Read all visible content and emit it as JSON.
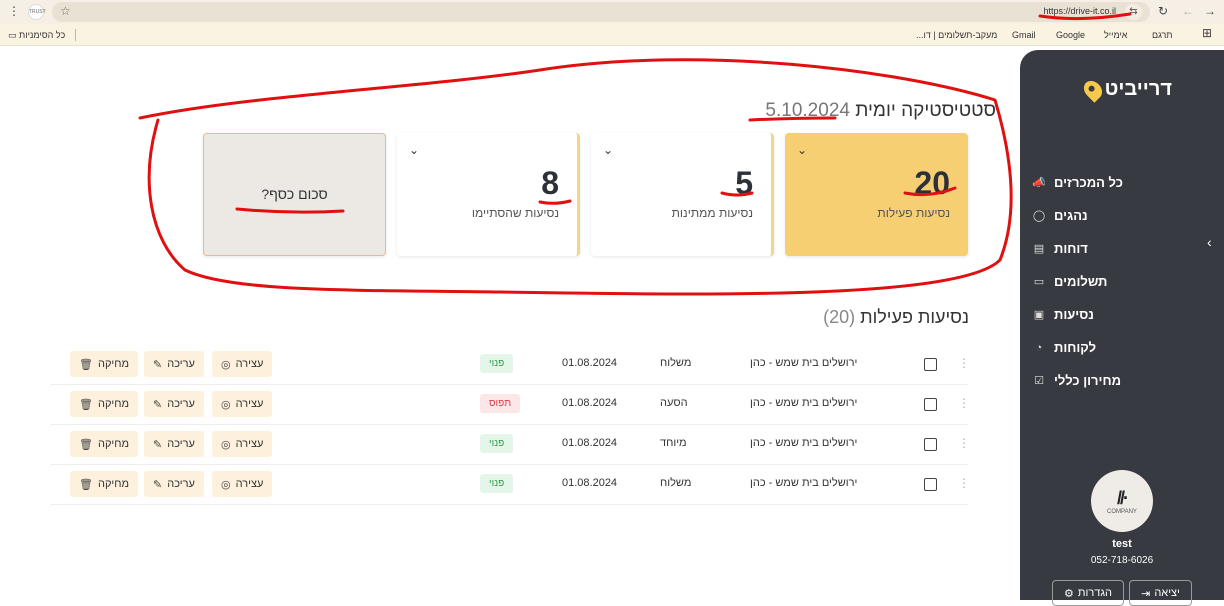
{
  "browser": {
    "url": "https://drive-it.co.il",
    "tune_icon": "tune-icon",
    "star_icon": "star-icon",
    "menu_icon": "kebab-menu-icon",
    "reload_icon": "reload-icon",
    "back_icon": "back-arrow-icon",
    "forward_icon": "forward-arrow-icon",
    "apps_icon": "apps-grid-icon",
    "extension_logo_text": "TRUST"
  },
  "bookmarks": {
    "items": [
      "תרגם",
      "אימייל",
      "Google",
      "Gmail",
      "מעקב-תשלומים | דו..."
    ],
    "all_bookmarks": "כל הסימניות"
  },
  "sidebar": {
    "logo": "דרייביט",
    "items": [
      {
        "label": "כל המכרזים",
        "icon": "megaphone-icon"
      },
      {
        "label": "נהגים",
        "icon": "user-icon"
      },
      {
        "label": "דוחות",
        "icon": "report-icon"
      },
      {
        "label": "תשלומים",
        "icon": "credit-card-icon"
      },
      {
        "label": "נסיעות",
        "icon": "bus-icon"
      },
      {
        "label": "לקוחות",
        "icon": "customers-icon"
      },
      {
        "label": "מחירון כללי",
        "icon": "price-list-icon"
      }
    ],
    "user": {
      "name": "test",
      "phone": "052-718-6026",
      "company": "COMPANY"
    },
    "logout": "יציאה",
    "settings": "הגדרות"
  },
  "stats": {
    "title": "סטטיסטיקה יומית",
    "date": "5.10.2024",
    "cards": [
      {
        "value": "20",
        "label": "נסיעות פעילות"
      },
      {
        "value": "5",
        "label": "נסיעות ממתינות"
      },
      {
        "value": "8",
        "label": "נסיעות שהסתיימו"
      }
    ],
    "money_label": "סכום כסף?"
  },
  "active_rides": {
    "title": "נסיעות פעילות",
    "count": "(20)",
    "actions": {
      "stop": "עצירה",
      "edit": "עריכה",
      "delete": "מחיקה"
    },
    "rows": [
      {
        "route": "ירושלים בית שמש - כהן",
        "vehicle": "משלוח",
        "date": "01.08.2024",
        "status": "פנוי",
        "status_type": "free"
      },
      {
        "route": "ירושלים בית שמש - כהן",
        "vehicle": "הסעה",
        "date": "01.08.2024",
        "status": "תפוס",
        "status_type": "busy"
      },
      {
        "route": "ירושלים בית שמש - כהן",
        "vehicle": "מיוחד",
        "date": "01.08.2024",
        "status": "פנוי",
        "status_type": "free"
      },
      {
        "route": "ירושלים בית שמש - כהן",
        "vehicle": "משלוח",
        "date": "01.08.2024",
        "status": "פנוי",
        "status_type": "free"
      }
    ]
  },
  "colors": {
    "accent": "#f6cf73",
    "sidebar": "#373a40",
    "annotation": "#e01010"
  }
}
